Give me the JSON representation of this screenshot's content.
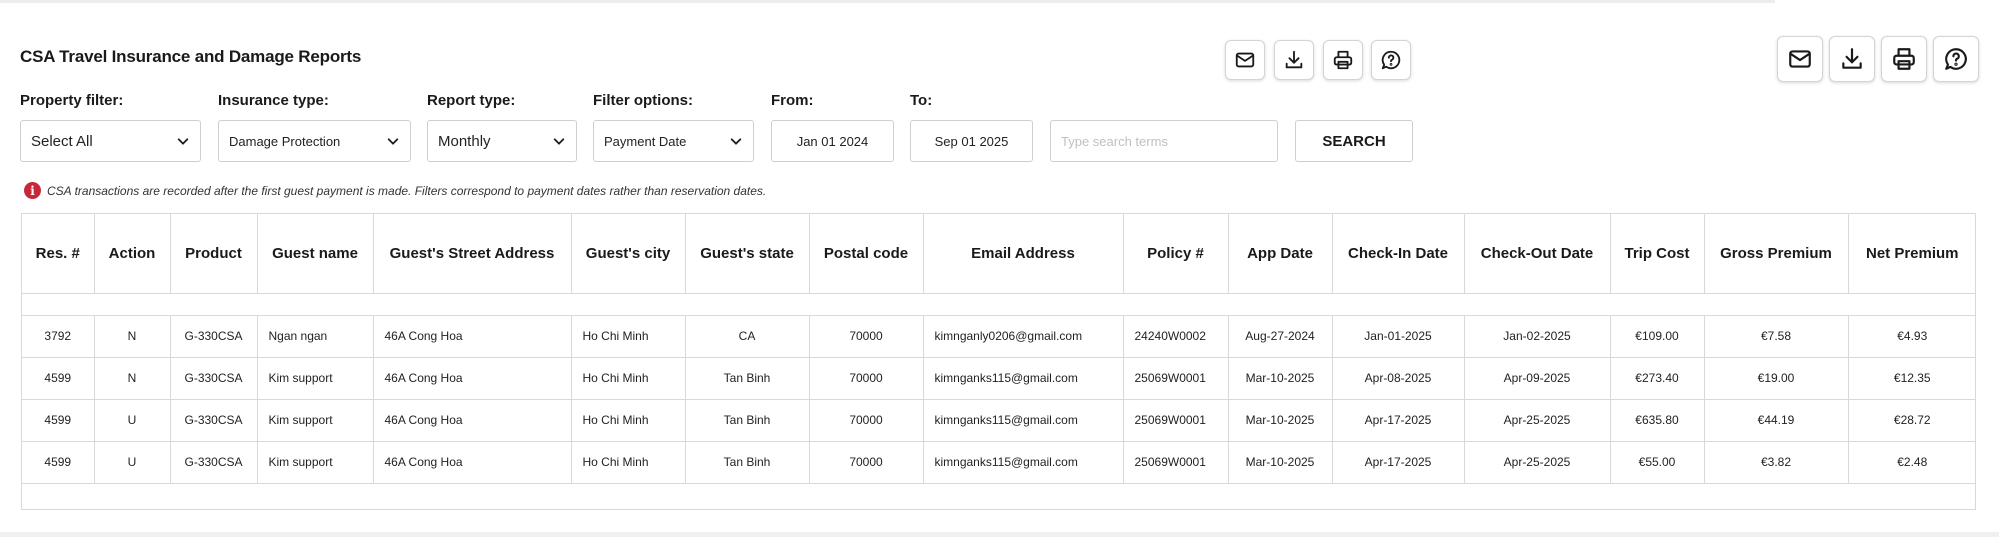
{
  "page": {
    "title": "CSA Travel Insurance and Damage Reports"
  },
  "toolbar": {
    "icons": [
      "mail-icon",
      "download-icon",
      "print-icon",
      "help-chat-icon"
    ]
  },
  "filters": {
    "property_label": "Property filter:",
    "property_value": "Select All",
    "insurance_label": "Insurance type:",
    "insurance_value": "Damage Protection",
    "report_label": "Report type:",
    "report_value": "Monthly",
    "options_label": "Filter options:",
    "options_value": "Payment Date",
    "from_label": "From:",
    "from_value": "Jan 01 2024",
    "to_label": "To:",
    "to_value": "Sep 01 2025",
    "search_placeholder": "Type search terms",
    "search_button": "SEARCH"
  },
  "note": "CSA transactions are recorded after the first guest payment is made. Filters correspond to payment dates rather than reservation dates.",
  "table": {
    "columns": [
      "Res. #",
      "Action",
      "Product",
      "Guest name",
      "Guest's Street Address",
      "Guest's city",
      "Guest's state",
      "Postal code",
      "Email Address",
      "Policy #",
      "App Date",
      "Check-In Date",
      "Check-Out Date",
      "Trip Cost",
      "Gross Premium",
      "Net Premium"
    ],
    "rows": [
      [
        "3792",
        "N",
        "G-330CSA",
        "Ngan ngan",
        "46A Cong Hoa",
        "Ho Chi Minh",
        "CA",
        "70000",
        "kimnganly0206@gmail.com",
        "24240W0002",
        "Aug-27-2024",
        "Jan-01-2025",
        "Jan-02-2025",
        "€109.00",
        "€7.58",
        "€4.93"
      ],
      [
        "4599",
        "N",
        "G-330CSA",
        "Kim support",
        "46A Cong Hoa",
        "Ho Chi Minh",
        "Tan Binh",
        "70000",
        "kimnganks115@gmail.com",
        "25069W0001",
        "Mar-10-2025",
        "Apr-08-2025",
        "Apr-09-2025",
        "€273.40",
        "€19.00",
        "€12.35"
      ],
      [
        "4599",
        "U",
        "G-330CSA",
        "Kim support",
        "46A Cong Hoa",
        "Ho Chi Minh",
        "Tan Binh",
        "70000",
        "kimnganks115@gmail.com",
        "25069W0001",
        "Mar-10-2025",
        "Apr-17-2025",
        "Apr-25-2025",
        "€635.80",
        "€44.19",
        "€28.72"
      ],
      [
        "4599",
        "U",
        "G-330CSA",
        "Kim support",
        "46A Cong Hoa",
        "Ho Chi Minh",
        "Tan Binh",
        "70000",
        "kimnganks115@gmail.com",
        "25069W0001",
        "Mar-10-2025",
        "Apr-17-2025",
        "Apr-25-2025",
        "€55.00",
        "€3.82",
        "€2.48"
      ]
    ]
  },
  "colors": {
    "info_icon": "#c62839",
    "border": "#d9d9d9"
  }
}
